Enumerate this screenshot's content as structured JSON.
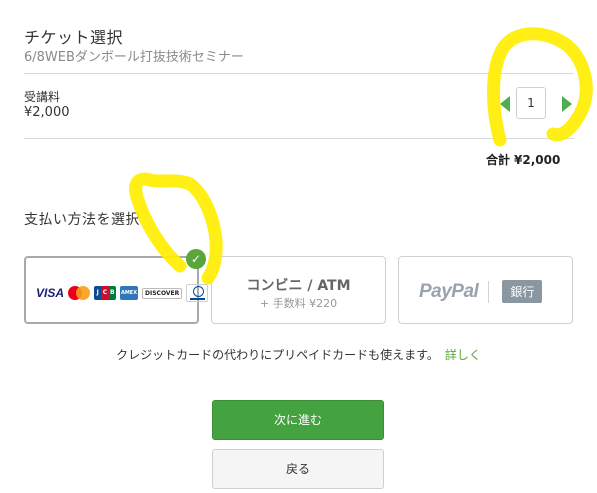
{
  "ticket": {
    "title": "チケット選択",
    "event_name": "6/8WEBダンボール打抜技術セミナー",
    "item_name": "受講料",
    "item_price": "¥2,000",
    "quantity": "1",
    "total_label": "合計",
    "total_value": "¥2,000"
  },
  "payment": {
    "title": "支払い方法を選択",
    "selected": "credit-card",
    "card_brands": {
      "visa": "VISA",
      "jcb": [
        "J",
        "C",
        "B"
      ],
      "amex": "AMEX",
      "discover": "DISCOVER"
    },
    "convenience": {
      "label": "コンビニ / ATM",
      "fee": "+ 手数料 ¥220"
    },
    "paypal": {
      "label": "PayPal",
      "bank_label": "銀行"
    },
    "note": "クレジットカードの代わりにプリペイドカードも使えます。",
    "note_link": "詳しく"
  },
  "buttons": {
    "next": "次に進む",
    "back": "戻る"
  },
  "colors": {
    "accent_green": "#44a340",
    "annotation_yellow": "#ffee00"
  },
  "icons": {
    "selected_check": "check-icon",
    "step_minus": "triangle-left-icon",
    "step_plus": "triangle-right-icon"
  }
}
